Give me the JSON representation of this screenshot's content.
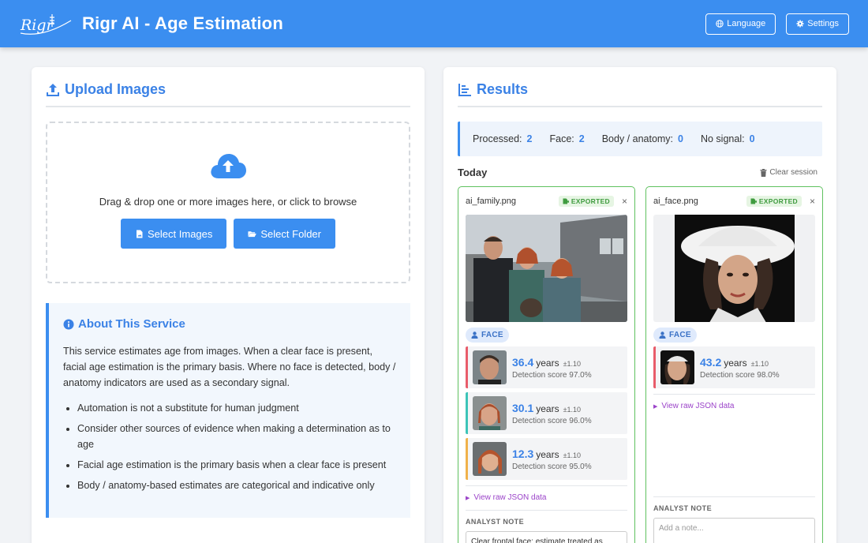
{
  "header": {
    "logo_text": "Rigr",
    "title": "Rigr AI - Age Estimation",
    "language_label": "Language",
    "settings_label": "Settings"
  },
  "upload": {
    "title": "Upload Images",
    "drop_text": "Drag & drop one or more images here, or click to browse",
    "select_images_label": "Select Images",
    "select_folder_label": "Select Folder"
  },
  "about": {
    "title": "About This Service",
    "body": "This service estimates age from images. When a clear face is present, facial age estimation is the primary basis. Where no face is detected, body / anatomy indicators are used as a secondary signal.",
    "bullets": [
      "Automation is not a substitute for human judgment",
      "Consider other sources of evidence when making a determination as to age",
      "Facial age estimation is the primary basis when a clear face is present",
      "Body / anatomy-based estimates are categorical and indicative only"
    ]
  },
  "results": {
    "title": "Results",
    "stats": [
      {
        "label": "Processed:",
        "value": "2"
      },
      {
        "label": "Face:",
        "value": "2"
      },
      {
        "label": "Body / anatomy:",
        "value": "0"
      },
      {
        "label": "No signal:",
        "value": "0"
      }
    ],
    "group_label": "Today",
    "clear_label": "Clear session",
    "cards": [
      {
        "filename": "ai_family.png",
        "status": "EXPORTED",
        "close": "×",
        "badge": "FACE",
        "faces": [
          {
            "age": "36.4",
            "unit": "years",
            "pm": "±1.10",
            "score": "Detection score 97.0%"
          },
          {
            "age": "30.1",
            "unit": "years",
            "pm": "±1.10",
            "score": "Detection score 96.0%"
          },
          {
            "age": "12.3",
            "unit": "years",
            "pm": "±1.10",
            "score": "Detection score 95.0%"
          }
        ],
        "raw_label": "View raw JSON data",
        "note_label": "ANALYST NOTE",
        "note_value": "Clear frontal face; estimate treated as"
      },
      {
        "filename": "ai_face.png",
        "status": "EXPORTED",
        "close": "×",
        "badge": "FACE",
        "faces": [
          {
            "age": "43.2",
            "unit": "years",
            "pm": "±1.10",
            "score": "Detection score 98.0%"
          }
        ],
        "raw_label": "View raw JSON data",
        "note_label": "ANALYST NOTE",
        "note_placeholder": "Add a note..."
      }
    ]
  },
  "colors": {
    "header_bg": "#3b8ef0",
    "accent": "#3b82e6",
    "exported_green": "#3f9b3f",
    "card_border": "#5fc15f",
    "raw_link": "#9b43c9"
  },
  "icons": [
    "upload-icon",
    "cloud-upload-icon",
    "globe-icon",
    "gear-icon",
    "file-icon",
    "folder-icon",
    "info-icon",
    "chart-icon",
    "trash-icon",
    "export-icon",
    "user-icon",
    "close-icon"
  ]
}
